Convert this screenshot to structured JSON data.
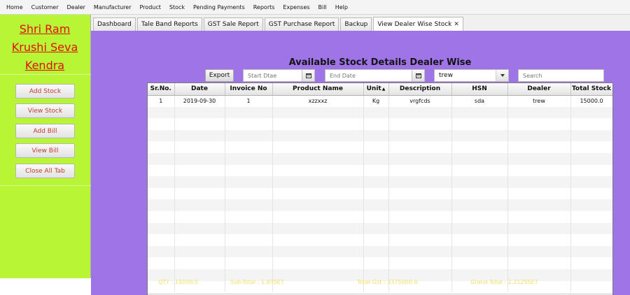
{
  "menu": [
    "Home",
    "Customer",
    "Dealer",
    "Manufacturer",
    "Product",
    "Stock",
    "Pending Payments",
    "Reports",
    "Expenses",
    "Bill",
    "Help"
  ],
  "sidebar": {
    "brand_lines": [
      "Shri Ram",
      "Krushi Seva",
      "Kendra"
    ],
    "buttons": [
      "Add Stock",
      "View Stock",
      "Add Bill",
      "View Bill",
      "Close All Tab"
    ]
  },
  "tabs": [
    {
      "label": "Dashboard"
    },
    {
      "label": "Tale Band Reports"
    },
    {
      "label": "GST Sale Report"
    },
    {
      "label": "GST Purchase Report"
    },
    {
      "label": "Backup"
    },
    {
      "label": "View Dealer Wise Stock",
      "close": "✕"
    }
  ],
  "main": {
    "title": "Available Stock Details Dealer Wise",
    "export_label": "Export",
    "start_date_placeholder": "Start Dtae",
    "end_date_placeholder": "End Date",
    "dealer_selected": "trew",
    "search_placeholder": "Search"
  },
  "table": {
    "columns": [
      "Sr.No.",
      "Date",
      "Invoice No",
      "Product Name",
      "Unit",
      "Description",
      "HSN",
      "Dealer",
      "Total Stock"
    ],
    "sort_indicator": "▲",
    "rows": [
      [
        "1",
        "2019-09-30",
        "1",
        "xzzxxz",
        "Kg",
        "vrgfcds",
        "sda",
        "trew",
        "15000.0"
      ]
    ]
  },
  "totals": {
    "qty": "QTY : 15000.0",
    "subtotal": "Sub-Total : 1.875E7",
    "total_gst": "Total-Gst : 3375000.0",
    "grand_total": "Grand Total : 2.21255E7"
  },
  "colors": {
    "sidebar_bg": "#b8f534",
    "main_bg": "#9e74e6",
    "brand_text": "#e01010",
    "totals_text": "#f2e067"
  }
}
